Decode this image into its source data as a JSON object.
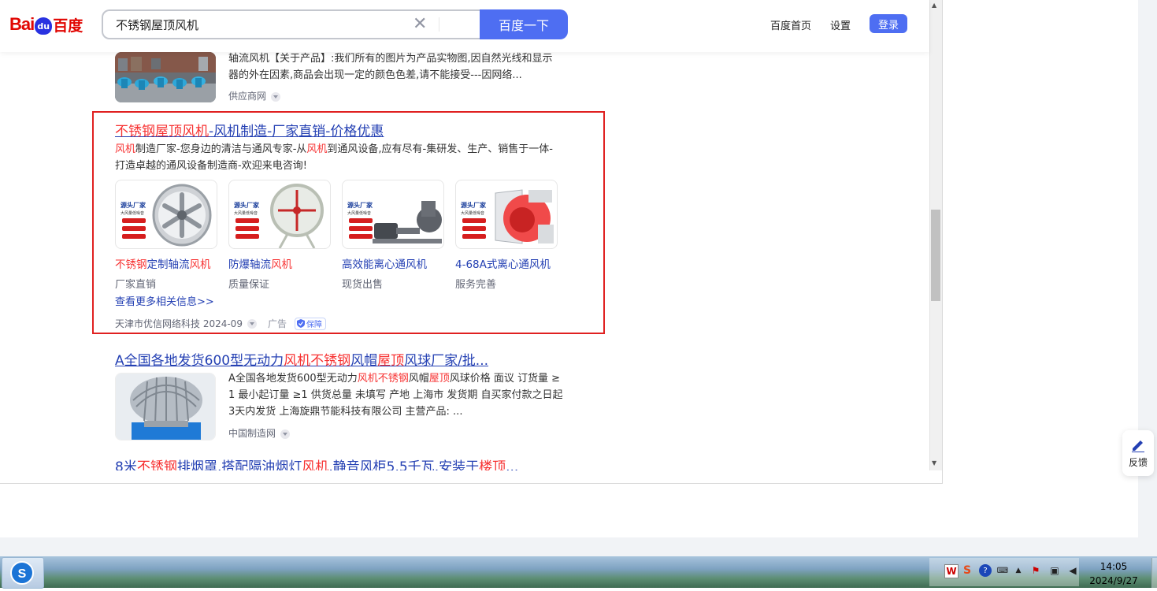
{
  "header": {
    "logo_bai": "Bai",
    "logo_du": "du",
    "logo_cn": "百度",
    "search_value": "不锈钢屋顶风机",
    "search_button": "百度一下",
    "nav": [
      "百度首页",
      "设置"
    ],
    "login": "登录"
  },
  "result1": {
    "desc_line1": "轴流风机【关于产品】:我们所有的图片为产品实物图,因自然光线和显示",
    "desc_line2": "器的外在因素,商品会出现一定的颜色色差,请不能接受---因网络...",
    "source": "供应商网"
  },
  "ad": {
    "title_red": "不锈钢屋顶风机",
    "title_rest": "-风机制造-厂家直销-价格优惠",
    "desc_red1": "风机",
    "desc_part1": "制造厂家-您身边的清洁与通风专家-从",
    "desc_red2": "风机",
    "desc_part2": "到通风设备,应有尽有-集研发、生产、销售于一体-",
    "desc_line2": "打造卓越的通风设备制造商-欢迎来电咨询!",
    "card_badge": "源头厂家",
    "card_badge_sub": "大风量低噪音",
    "cards": [
      {
        "title_red": "不锈钢",
        "title_mid": "定制轴流",
        "title_red2": "风机",
        "sub": "厂家直销"
      },
      {
        "title_red": "",
        "title_mid": "防爆轴流",
        "title_red2": "风机",
        "sub": "质量保证"
      },
      {
        "title_red": "",
        "title_mid": "高效能离心通风机",
        "title_red2": "",
        "sub": "现货出售"
      },
      {
        "title_red": "",
        "title_mid": "4-68A式离心通风机",
        "title_red2": "",
        "sub": "服务完善"
      }
    ],
    "more": "查看更多相关信息>>",
    "footer_source": "天津市优信网络科技 2024-09",
    "footer_ad": "广告",
    "footer_badge": "保障"
  },
  "result3": {
    "title_parts": [
      {
        "t": "A全国各地发货600型无动力",
        "red": false
      },
      {
        "t": "风机",
        "red": true
      },
      {
        "t": "不锈钢",
        "red": true
      },
      {
        "t": "风帽",
        "red": false
      },
      {
        "t": "屋顶",
        "red": true
      },
      {
        "t": "风球厂家/批...",
        "red": false
      }
    ],
    "desc_a": "A全国各地发货600型无动力",
    "desc_r1": "风机",
    "desc_r2": "不锈钢",
    "desc_b": "风帽",
    "desc_r3": "屋顶",
    "desc_c": "风球价格 面议 订货量 ≥",
    "desc_line2": "1 最小起订量 ≥1 供货总量 未填写 产地 上海市 发货期 自买家付款之日起",
    "desc_line3": "3天内发货 上海旋鼎节能科技有限公司 主营产品: ...",
    "source": "中国制造网"
  },
  "result4": {
    "title_parts": [
      {
        "t": "8米",
        "red": false
      },
      {
        "t": "不锈钢",
        "red": true
      },
      {
        "t": "排烟罩,搭配隔油烟灯",
        "red": false
      },
      {
        "t": "风机",
        "red": true
      },
      {
        "t": ",静音风柜5.5千瓦,安装于",
        "red": false
      },
      {
        "t": "楼顶",
        "red": true
      },
      {
        "t": "...",
        "red": false
      }
    ]
  },
  "feedback": "反馈",
  "taskbar": {
    "time": "14:05",
    "date": "2024/9/27"
  },
  "colors": {
    "accent": "#4e6ef2",
    "link": "#2440b3",
    "highlight": "#f73131",
    "box_border": "#e02020"
  }
}
